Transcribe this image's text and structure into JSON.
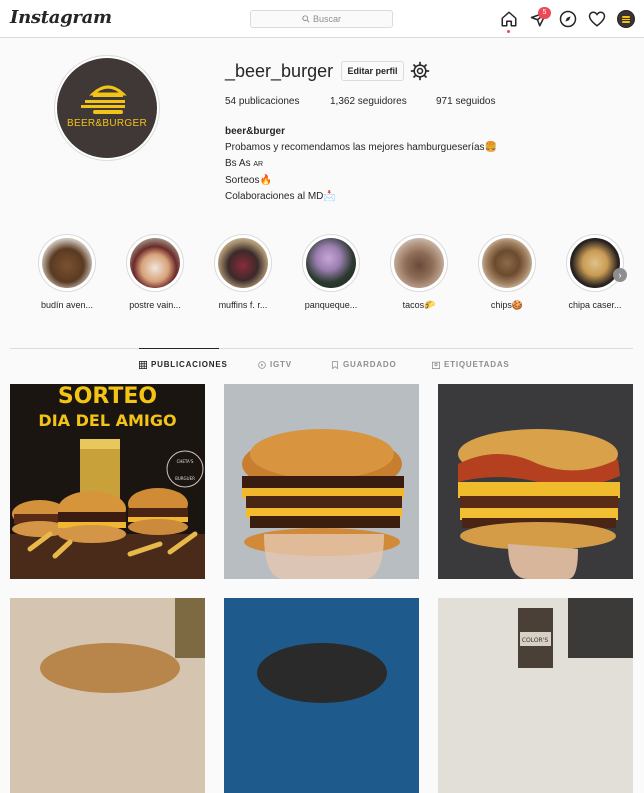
{
  "app": {
    "logo": "Instagram"
  },
  "search": {
    "placeholder": "Buscar",
    "icon": "search-icon"
  },
  "nav": {
    "notifications_count": "5"
  },
  "profile": {
    "username": "_beer_burger",
    "edit_button": "Editar perfil",
    "avatar_brand": "BEER&BURGER",
    "stats": {
      "posts": "54 publicaciones",
      "followers": "1,362 seguidores",
      "following": "971 seguidos"
    },
    "bio": {
      "name": "beer&burger",
      "line1": "Probamos y recomendamos las mejores hamburgueserías🍔",
      "line2_main": "Bs As ",
      "line2_flag": "AR",
      "line3": "Sorteos🔥",
      "line4": "Colaboraciones al MD📩"
    }
  },
  "highlights": [
    {
      "label": "budín aven..."
    },
    {
      "label": "postre vain..."
    },
    {
      "label": "muffins f. r..."
    },
    {
      "label": "panqueque..."
    },
    {
      "label": "tacos🌮"
    },
    {
      "label": "chips🍪"
    },
    {
      "label": "chipa caser..."
    }
  ],
  "tabs": [
    {
      "label": "PUBLICACIONES",
      "icon": "grid-icon"
    },
    {
      "label": "IGTV",
      "icon": "igtv-icon"
    },
    {
      "label": "GUARDADO",
      "icon": "bookmark-icon"
    },
    {
      "label": "ETIQUETADAS",
      "icon": "tag-icon"
    }
  ],
  "posts": [
    {
      "title_line1": "SORTEO",
      "title_line2": "DIA DEL AMIGO",
      "stamp_line1": "CHETA'S",
      "stamp_line2": "BURGUER"
    },
    {},
    {},
    {},
    {},
    {
      "label": "COLOR'S"
    }
  ],
  "colors": {
    "accent": "#ed4956",
    "brand_yellow": "#f3c316",
    "border": "#dbdbdb"
  }
}
